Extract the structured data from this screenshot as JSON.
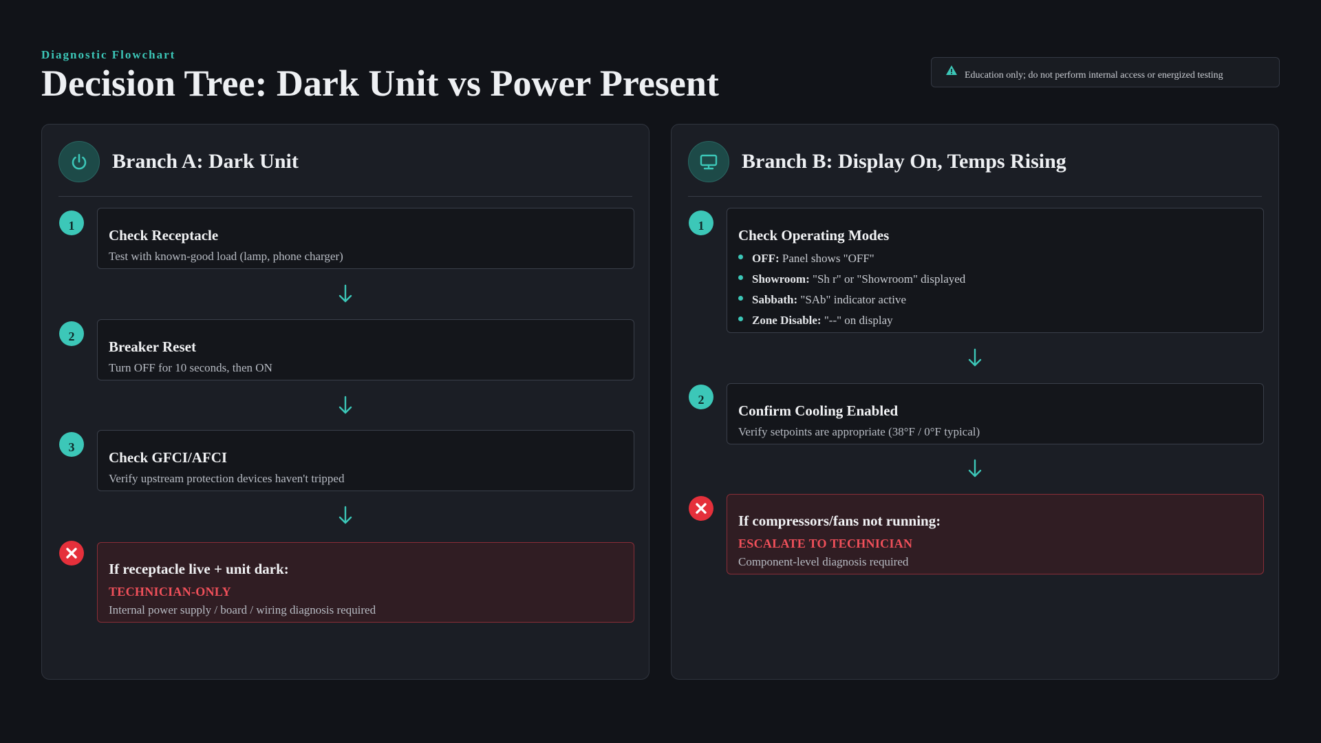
{
  "header": {
    "kicker": "Diagnostic Flowchart",
    "title": "Decision Tree: Dark Unit vs Power Present",
    "disclaimer": "Education only; do not perform internal access or energized testing"
  },
  "colors": {
    "accent": "#3cc7b8",
    "danger": "#e5303b",
    "danger_text": "#f0505a",
    "background": "#111318",
    "panel": "#1b1e25"
  },
  "branch_a": {
    "icon": "power-icon",
    "title": "Branch A: Dark Unit",
    "steps": [
      {
        "num": "1",
        "title": "Check Receptacle",
        "desc": "Test with known-good load (lamp, phone charger)"
      },
      {
        "num": "2",
        "title": "Breaker Reset",
        "desc": "Turn OFF for 10 seconds, then ON"
      },
      {
        "num": "3",
        "title": "Check GFCI/AFCI",
        "desc": "Verify upstream protection devices haven't tripped"
      }
    ],
    "outcome": {
      "icon": "close-icon",
      "title": "If receptacle live + unit dark:",
      "flag": "TECHNICIAN-ONLY",
      "desc": "Internal power supply / board / wiring diagnosis required"
    }
  },
  "branch_b": {
    "icon": "monitor-icon",
    "title": "Branch B: Display On, Temps Rising",
    "steps": [
      {
        "num": "1",
        "title": "Check Operating Modes",
        "modes": [
          {
            "label": "OFF:",
            "text": "Panel shows \"OFF\""
          },
          {
            "label": "Showroom:",
            "text": "\"Sh r\" or \"Showroom\" displayed"
          },
          {
            "label": "Sabbath:",
            "text": "\"SAb\" indicator active"
          },
          {
            "label": "Zone Disable:",
            "text": "\"--\" on display"
          }
        ]
      },
      {
        "num": "2",
        "title": "Confirm Cooling Enabled",
        "desc": "Verify setpoints are appropriate (38°F / 0°F typical)"
      }
    ],
    "outcome": {
      "icon": "close-icon",
      "title": "If compressors/fans not running:",
      "flag": "ESCALATE TO TECHNICIAN",
      "desc": "Component-level diagnosis required"
    }
  }
}
